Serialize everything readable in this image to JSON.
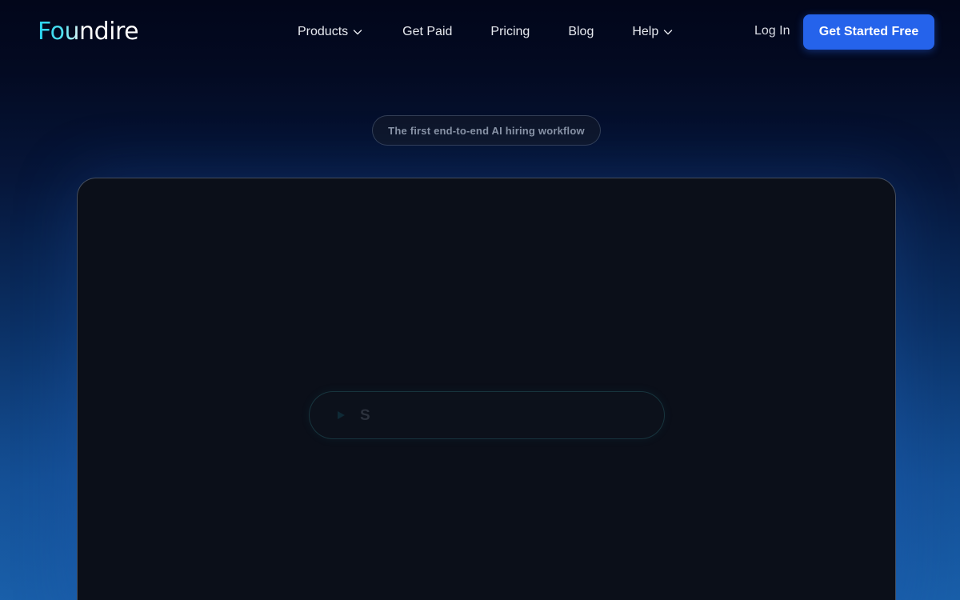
{
  "brand": {
    "logo_text": "Foundire",
    "accent_color": "#27d3f0"
  },
  "nav": {
    "items": [
      {
        "label": "Products",
        "has_dropdown": true,
        "icon": "chevron-down-icon"
      },
      {
        "label": "Get Paid",
        "has_dropdown": false
      },
      {
        "label": "Pricing",
        "has_dropdown": false
      },
      {
        "label": "Blog",
        "has_dropdown": false
      },
      {
        "label": "Help",
        "has_dropdown": true,
        "icon": "chevron-down-icon"
      }
    ],
    "login_label": "Log In",
    "cta_label": "Get Started Free",
    "cta_color": "#2563eb"
  },
  "hero": {
    "badge_text": "The first end-to-end AI hiring workflow"
  },
  "panel": {
    "search_text": "S",
    "search_icon": "play-icon"
  }
}
